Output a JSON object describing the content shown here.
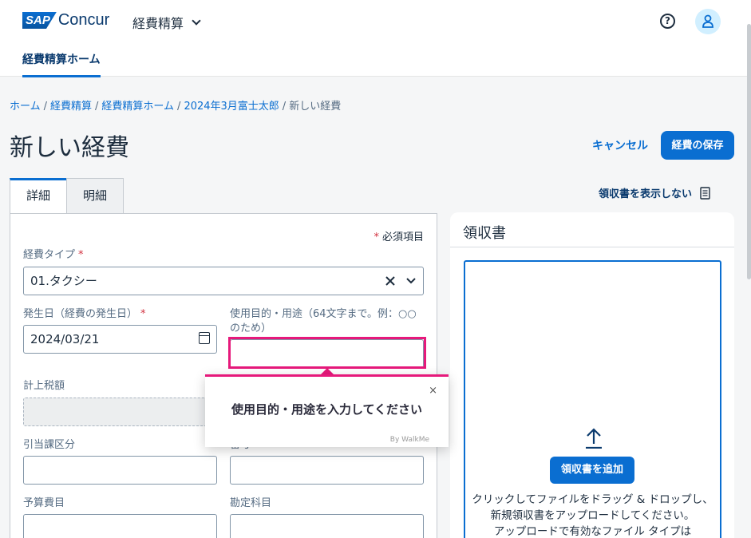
{
  "header": {
    "logo_sap": "SAP",
    "logo_concur": "Concur",
    "app_menu_label": "経費精算",
    "help_glyph": "?",
    "nav_tab": "経費精算ホーム"
  },
  "breadcrumb": {
    "items": [
      "ホーム",
      "経費精算",
      "経費精算ホーム",
      "2024年3月富士太郎"
    ],
    "current": "新しい経費",
    "separator": "/"
  },
  "page": {
    "title": "新しい経費",
    "cancel_label": "キャンセル",
    "save_label": "経費の保存",
    "hide_receipt_label": "領収書を表示しない"
  },
  "tabs": [
    {
      "label": "詳細",
      "active": true
    },
    {
      "label": "明細",
      "active": false
    }
  ],
  "form": {
    "required_note": "必須項目",
    "required_star": "*",
    "expense_type_label": "経費タイプ",
    "expense_type_value": "01.タクシー",
    "date_label": "発生日（経費の発生日）",
    "date_value": "2024/03/21",
    "purpose_label": "使用目的・用途（64文字まで。例：○○のため）",
    "purpose_value": "",
    "tax_amount_label": "計上税額",
    "charge_section_label": "引当課区分",
    "partial_label": "番号",
    "budget_label": "予算費目",
    "account_label": "勘定科目"
  },
  "receipt": {
    "title": "領収書",
    "add_button": "領収書を追加",
    "drop_text_1": "クリックしてファイルをドラッグ & ドロップし、",
    "drop_text_2": "新規領収書をアップロードしてください。",
    "drop_text_3": "アップロードで有効なファイル タイプは"
  },
  "tooltip": {
    "close_glyph": "×",
    "message": "使用目的・用途を入力してください",
    "brand": "By WalkMe"
  },
  "colors": {
    "accent": "#0a6ed1",
    "highlight": "#e6197b",
    "required": "#d1303f"
  }
}
